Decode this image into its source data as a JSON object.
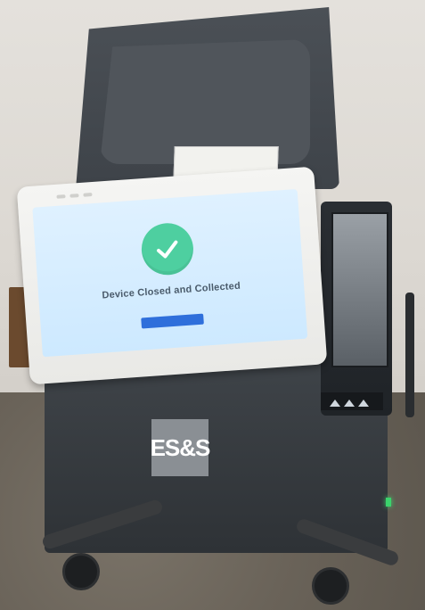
{
  "scene": {
    "brand": "ES&S",
    "screen": {
      "title": "Device Closed and Collected",
      "subtitle": "",
      "instruction": "",
      "button_label": "",
      "footer_text": ""
    },
    "icons": {
      "checkmark": "check-circle-icon"
    },
    "colors": {
      "screen_bg": "#dff1ff",
      "check_bg": "#4ecfa0",
      "button_bg": "#2f6fdb",
      "led": "#3bd46c"
    }
  }
}
